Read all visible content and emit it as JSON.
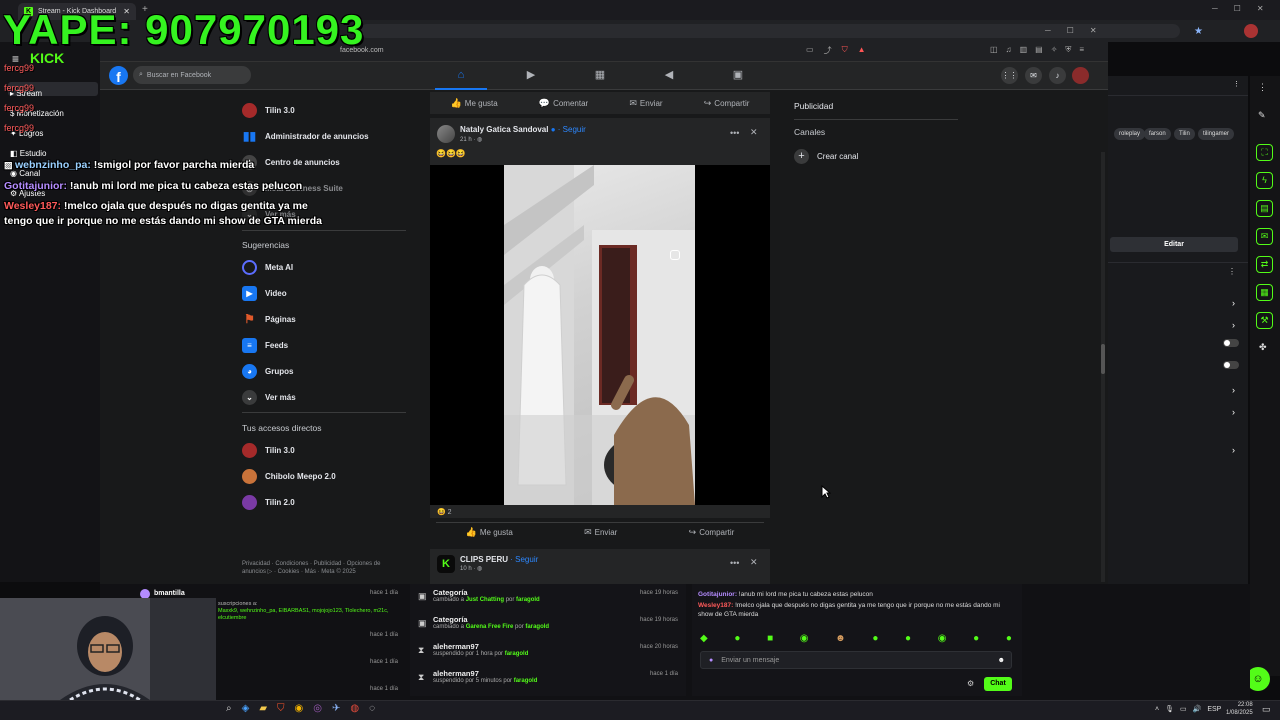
{
  "outer_browser": {
    "tab_title": "Stream - Kick Dashboard"
  },
  "inner_browser": {
    "url": "facebook.com"
  },
  "overlay": {
    "yape_text": "YAPE: 907970193",
    "chat": [
      {
        "user": "webnzinho_pa:",
        "text": " !smigol por favor parcha mierda",
        "color": "#9ad0ff"
      },
      {
        "user": "Gotitajunior:",
        "text": " !anub mi lord me pica tu cabeza estas pelucon",
        "color": "#b58cff"
      },
      {
        "user": "Wesley187:",
        "text": " !melco ojala que después no digas gentita ya me tengo que ir porque no me estás dando mi show de GTA mierda",
        "color": "#ff5a5a"
      }
    ]
  },
  "fb": {
    "search_placeholder": "Buscar en Facebook",
    "shortcuts_top": [
      {
        "label": "Tilin 3.0",
        "color": "#a52a2a"
      },
      {
        "label": "Administrador de anuncios",
        "color": "#1877f2"
      },
      {
        "label": "Centro de anuncios",
        "color": "#444"
      },
      {
        "label": "Meta Business Suite",
        "color": "#444"
      },
      {
        "label": "Ver más",
        "color": "#333"
      }
    ],
    "suggestions_heading": "Sugerencias",
    "suggestions": [
      {
        "label": "Meta AI",
        "icon": "meta-ai-icon",
        "color": "#5b6dff"
      },
      {
        "label": "Video",
        "icon": "video-icon",
        "color": "#1877f2"
      },
      {
        "label": "Páginas",
        "icon": "flag-icon",
        "color": "#e0592a"
      },
      {
        "label": "Feeds",
        "icon": "feeds-icon",
        "color": "#1877f2"
      },
      {
        "label": "Grupos",
        "icon": "groups-icon",
        "color": "#1877f2"
      },
      {
        "label": "Ver más",
        "icon": "chevron-down-icon",
        "color": "#3a3b3c"
      }
    ],
    "shortcuts_heading": "Tus accesos directos",
    "shortcuts": [
      {
        "label": "Tilin 3.0",
        "color": "#a52a2a"
      },
      {
        "label": "Chibolo Meepo 2.0",
        "color": "#c9733a"
      },
      {
        "label": "Tilin 2.0",
        "color": "#7a3aa5"
      }
    ],
    "footer": "Privacidad · Condiciones · Publicidad · Opciones de anuncios ▷ · Cookies · Más · Meta © 2025",
    "top_actions": {
      "like": "Me gusta",
      "comment": "Comentar",
      "send": "Enviar",
      "share": "Compartir"
    },
    "post": {
      "author": "Nataly Gatica Sandoval",
      "follow": "· Seguir",
      "time": "21 h · ◍",
      "emojis": "😆😆😆",
      "reactions_count": "2",
      "like": "Me gusta",
      "send": "Enviar",
      "share": "Compartir"
    },
    "next_post": {
      "author": "CLIPS PERU",
      "follow": "· Seguir",
      "time": "10 h · ◍"
    },
    "right": {
      "ads": "Publicidad",
      "channels": "Canales",
      "create_channel": "Crear canal"
    }
  },
  "kick_left_menu": [
    "Stream",
    "Monetización",
    "Logros",
    "Estudio",
    "Canal",
    "Ajustes"
  ],
  "kick_left_users": [
    "fercg99",
    "fercg99",
    "fercg99",
    "fercg99"
  ],
  "kick_right": {
    "tags": [
      "roleplay",
      "farson",
      "Tilin",
      "tilingamer"
    ],
    "edit_button": "Editar"
  },
  "bottom_left": {
    "user": "bmantilla",
    "subs_text": "suscripciones a:",
    "subs_names": "Maxxk9, wehnzinho_pa, EIBARBAS1, mojojojo123, Tlolechero, m21c, elcutiembre",
    "times": [
      "hace 1 día",
      "hace 1 día",
      "hace 1 día",
      "hace 1 día"
    ]
  },
  "activity": [
    {
      "title": "Categoría",
      "pre": "cambiado a ",
      "bold": "Just Chatting",
      "post": " por ",
      "who": "faragold",
      "time": "hace 19 horas",
      "icon": "category-icon"
    },
    {
      "title": "Categoría",
      "pre": "cambiado a ",
      "bold": "Garena Free Fire",
      "post": " por ",
      "who": "faragold",
      "time": "hace 19 horas",
      "icon": "category-icon"
    },
    {
      "title": "aleherman97",
      "pre": "suspendido por 1 hora por ",
      "bold": "",
      "post": "",
      "who": "faragold",
      "time": "hace 20 horas",
      "icon": "hourglass-icon"
    },
    {
      "title": "aleherman97",
      "pre": "suspendido por 5 minutos por ",
      "bold": "",
      "post": "",
      "who": "faragold",
      "time": "hace 1 día",
      "icon": "hourglass-icon"
    }
  ],
  "kick_chat": {
    "messages": [
      {
        "user": "Gotitajunior:",
        "text": " !anub mi lord me pica tu cabeza estas pelucon",
        "color": "#b58cff"
      },
      {
        "user": "Wesley187:",
        "text": " !melco ojala que después no digas gentita ya me tengo que ir porque no me estás dando mi show de GTA mierda",
        "color": "#ff5a5a"
      }
    ],
    "placeholder": "Enviar un mensaje",
    "send_button": "Chat"
  },
  "taskbar": {
    "lang": "ESP",
    "time": "22:08",
    "date": "1/08/2025"
  },
  "colors": {
    "kick_green": "#53fc18",
    "fb_blue": "#1877f2",
    "yape_green": "#35f320"
  }
}
